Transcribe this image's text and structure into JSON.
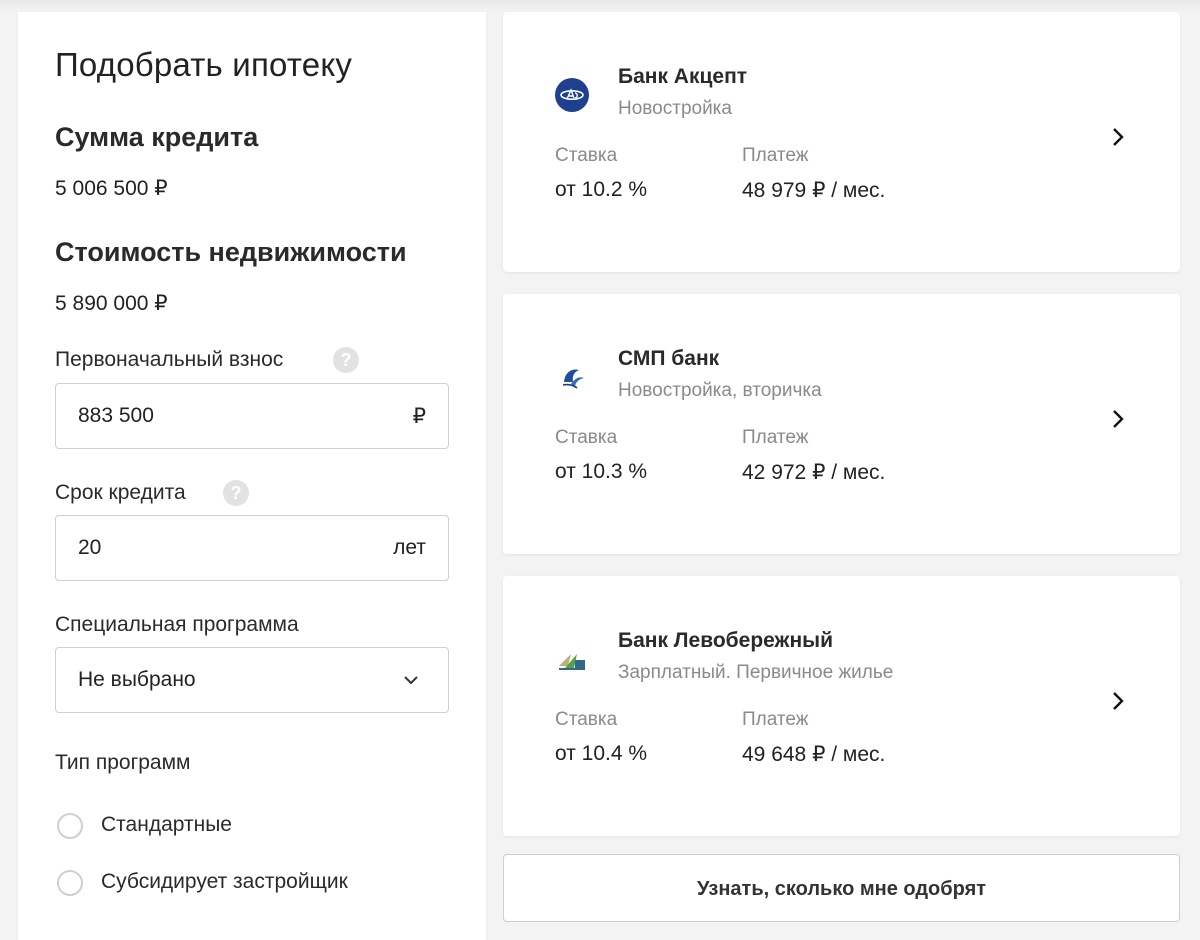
{
  "form": {
    "title": "Подобрать ипотеку",
    "loan_amount_label": "Сумма кредита",
    "loan_amount_value": "5 006 500 ₽",
    "property_cost_label": "Стоимость недвижимости",
    "property_cost_value": "5 890 000 ₽",
    "down_payment_label": "Первоначальный взнос",
    "down_payment_value": "883 500",
    "down_payment_suffix": "₽",
    "term_label": "Срок кредита",
    "term_value": "20",
    "term_suffix": "лет",
    "special_program_label": "Специальная программа",
    "special_program_value": "Не выбрано",
    "program_type_label": "Тип программ",
    "program_types": [
      "Стандартные",
      "Субсидирует застройщик"
    ],
    "help_glyph": "?"
  },
  "offers": [
    {
      "bank": "Банк Акцепт",
      "subtitle": "Новостройка",
      "rate_label": "Ставка",
      "rate_value": "от 10.2 %",
      "payment_label": "Платеж",
      "payment_value": "48 979 ₽ / мес.",
      "logo_icon": "bank-akcept-logo"
    },
    {
      "bank": "СМП банк",
      "subtitle": "Новостройка, вторичка",
      "rate_label": "Ставка",
      "rate_value": "от 10.3 %",
      "payment_label": "Платеж",
      "payment_value": "42 972 ₽ / мес.",
      "logo_icon": "smp-bank-logo"
    },
    {
      "bank": "Банк Левобережный",
      "subtitle": " Зарплатный. Первичное жилье",
      "rate_label": "Ставка",
      "rate_value": "от 10.4 %",
      "payment_label": "Платеж",
      "payment_value": "49 648 ₽ / мес.",
      "logo_icon": "levoberezhny-logo"
    }
  ],
  "cta_label": "Узнать, сколько мне одобрят",
  "colors": {
    "background": "#f3f3f3",
    "panel": "#ffffff",
    "border": "#cfcfcf",
    "muted_text": "#8a8a8a",
    "akcept_blue": "#1f3f8f"
  }
}
